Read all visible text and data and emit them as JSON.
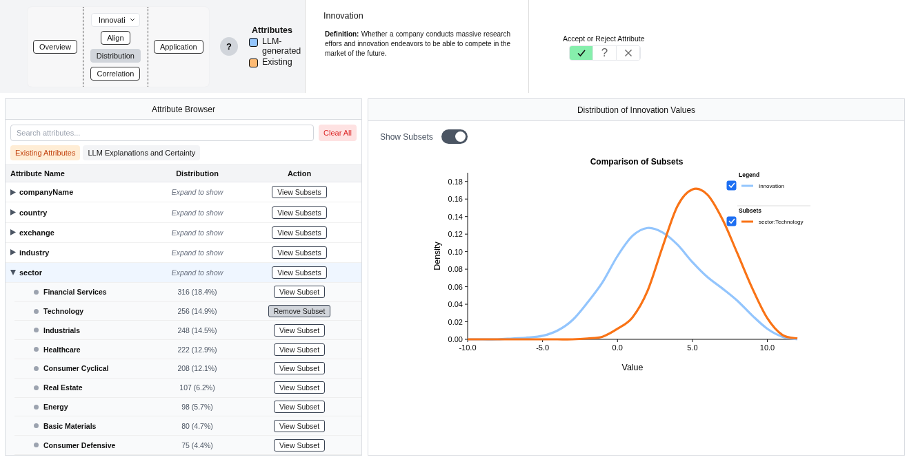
{
  "nav": {
    "overview": "Overview",
    "attribute_select": "Innovati",
    "views": [
      {
        "label": "Align",
        "selected": false
      },
      {
        "label": "Distribution",
        "selected": true
      },
      {
        "label": "Correlation",
        "selected": false
      }
    ],
    "application": "Application"
  },
  "help": "?",
  "attribute_legend": {
    "title": "Attributes",
    "items": [
      {
        "label": "LLM-generated",
        "color": "#93c5fd"
      },
      {
        "label": "Existing",
        "color": "#fdba74"
      }
    ]
  },
  "definition": {
    "title": "Innovation",
    "text": "**Definition:** Whether a company conducts massive research effors and innovation endeavors to be able to compete in the market of the future."
  },
  "verdict": {
    "label": "Accept or Reject Attribute",
    "options": [
      {
        "kind": "check",
        "selected": true
      },
      {
        "kind": "text",
        "label": "?",
        "selected": false
      },
      {
        "kind": "cross",
        "selected": false
      }
    ]
  },
  "browser": {
    "title": "Attribute Browser",
    "search": {
      "placeholder": "Search attributes..."
    },
    "clear": "Clear All",
    "tabs": [
      {
        "label": "Existing Attributes",
        "selected": true
      },
      {
        "label": "LLM Explanations and Certainty",
        "selected": false
      }
    ],
    "columns": [
      "Attribute Name",
      "Distribution",
      "Action"
    ],
    "rows": [
      {
        "name": "companyName",
        "distribution": "Expand to show",
        "action": "View Subsets",
        "expanded": false
      },
      {
        "name": "country",
        "distribution": "Expand to show",
        "action": "View Subsets",
        "expanded": false
      },
      {
        "name": "exchange",
        "distribution": "Expand to show",
        "action": "View Subsets",
        "expanded": false
      },
      {
        "name": "industry",
        "distribution": "Expand to show",
        "action": "View Subsets",
        "expanded": false
      },
      {
        "name": "sector",
        "distribution": "Expand to show",
        "action": "View Subsets",
        "expanded": true,
        "children": [
          {
            "name": "Financial Services",
            "count": "316 (18.4%)",
            "action": "View Subset",
            "selected": false
          },
          {
            "name": "Technology",
            "count": "256 (14.9%)",
            "action": "Remove Subset",
            "selected": true
          },
          {
            "name": "Industrials",
            "count": "248 (14.5%)",
            "action": "View Subset",
            "selected": false
          },
          {
            "name": "Healthcare",
            "count": "222 (12.9%)",
            "action": "View Subset",
            "selected": false
          },
          {
            "name": "Consumer Cyclical",
            "count": "208 (12.1%)",
            "action": "View Subset",
            "selected": false
          },
          {
            "name": "Real Estate",
            "count": "107 (6.2%)",
            "action": "View Subset",
            "selected": false
          },
          {
            "name": "Energy",
            "count": "98 (5.7%)",
            "action": "View Subset",
            "selected": false
          },
          {
            "name": "Basic Materials",
            "count": "80 (4.7%)",
            "action": "View Subset",
            "selected": false
          },
          {
            "name": "Consumer Defensive",
            "count": "75 (4.4%)",
            "action": "View Subset",
            "selected": false
          }
        ]
      }
    ]
  },
  "distribution": {
    "title": "Distribution of Innovation Values",
    "toggle": {
      "label": "Show Subsets",
      "on": true
    },
    "legend_groups": [
      {
        "title": "Legend",
        "items": [
          {
            "checked": true
          }
        ]
      },
      {
        "title": "Subsets",
        "items": [
          {
            "checked": true
          }
        ]
      }
    ],
    "chart_data": {
      "type": "line",
      "title": "Comparison of Subsets",
      "xlabel": "Value",
      "ylabel": "Density",
      "x": [
        -10,
        -9,
        -8,
        -7,
        -6,
        -5,
        -4,
        -3,
        -2,
        -1,
        0,
        1,
        2,
        3,
        4,
        5,
        6,
        7,
        8,
        9,
        10,
        11,
        12
      ],
      "series": [
        {
          "name": "Innovation",
          "color": "#93c5fd",
          "values": [
            0,
            0,
            0,
            0.001,
            0.002,
            0.004,
            0.01,
            0.022,
            0.042,
            0.065,
            0.095,
            0.118,
            0.127,
            0.122,
            0.108,
            0.088,
            0.071,
            0.058,
            0.044,
            0.027,
            0.012,
            0.003,
            0
          ]
        },
        {
          "name": "sector:Technology",
          "color": "#f97316",
          "values": [
            0,
            0,
            0,
            0,
            0,
            0,
            0,
            0,
            0.001,
            0.003,
            0.012,
            0.025,
            0.055,
            0.105,
            0.152,
            0.171,
            0.165,
            0.137,
            0.098,
            0.058,
            0.024,
            0.005,
            0.001
          ]
        }
      ],
      "legend": true,
      "xlim": [
        -10,
        12
      ],
      "ylim": [
        0,
        0.19
      ],
      "xticks": [
        {
          "value": -10,
          "label": "-10.0"
        },
        {
          "value": -5,
          "label": "-5.0"
        },
        {
          "value": 0,
          "label": "0.0"
        },
        {
          "value": 5,
          "label": "5.0"
        },
        {
          "value": 10,
          "label": "10.0"
        }
      ],
      "yticks": [
        {
          "value": 0,
          "label": "0.00"
        },
        {
          "value": 0.02,
          "label": "0.02"
        },
        {
          "value": 0.04,
          "label": "0.04"
        },
        {
          "value": 0.06,
          "label": "0.06"
        },
        {
          "value": 0.08,
          "label": "0.08"
        },
        {
          "value": 0.1,
          "label": "0.10"
        },
        {
          "value": 0.12,
          "label": "0.12"
        },
        {
          "value": 0.14,
          "label": "0.14"
        },
        {
          "value": 0.16,
          "label": "0.16"
        },
        {
          "value": 0.18,
          "label": "0.18"
        }
      ]
    }
  }
}
